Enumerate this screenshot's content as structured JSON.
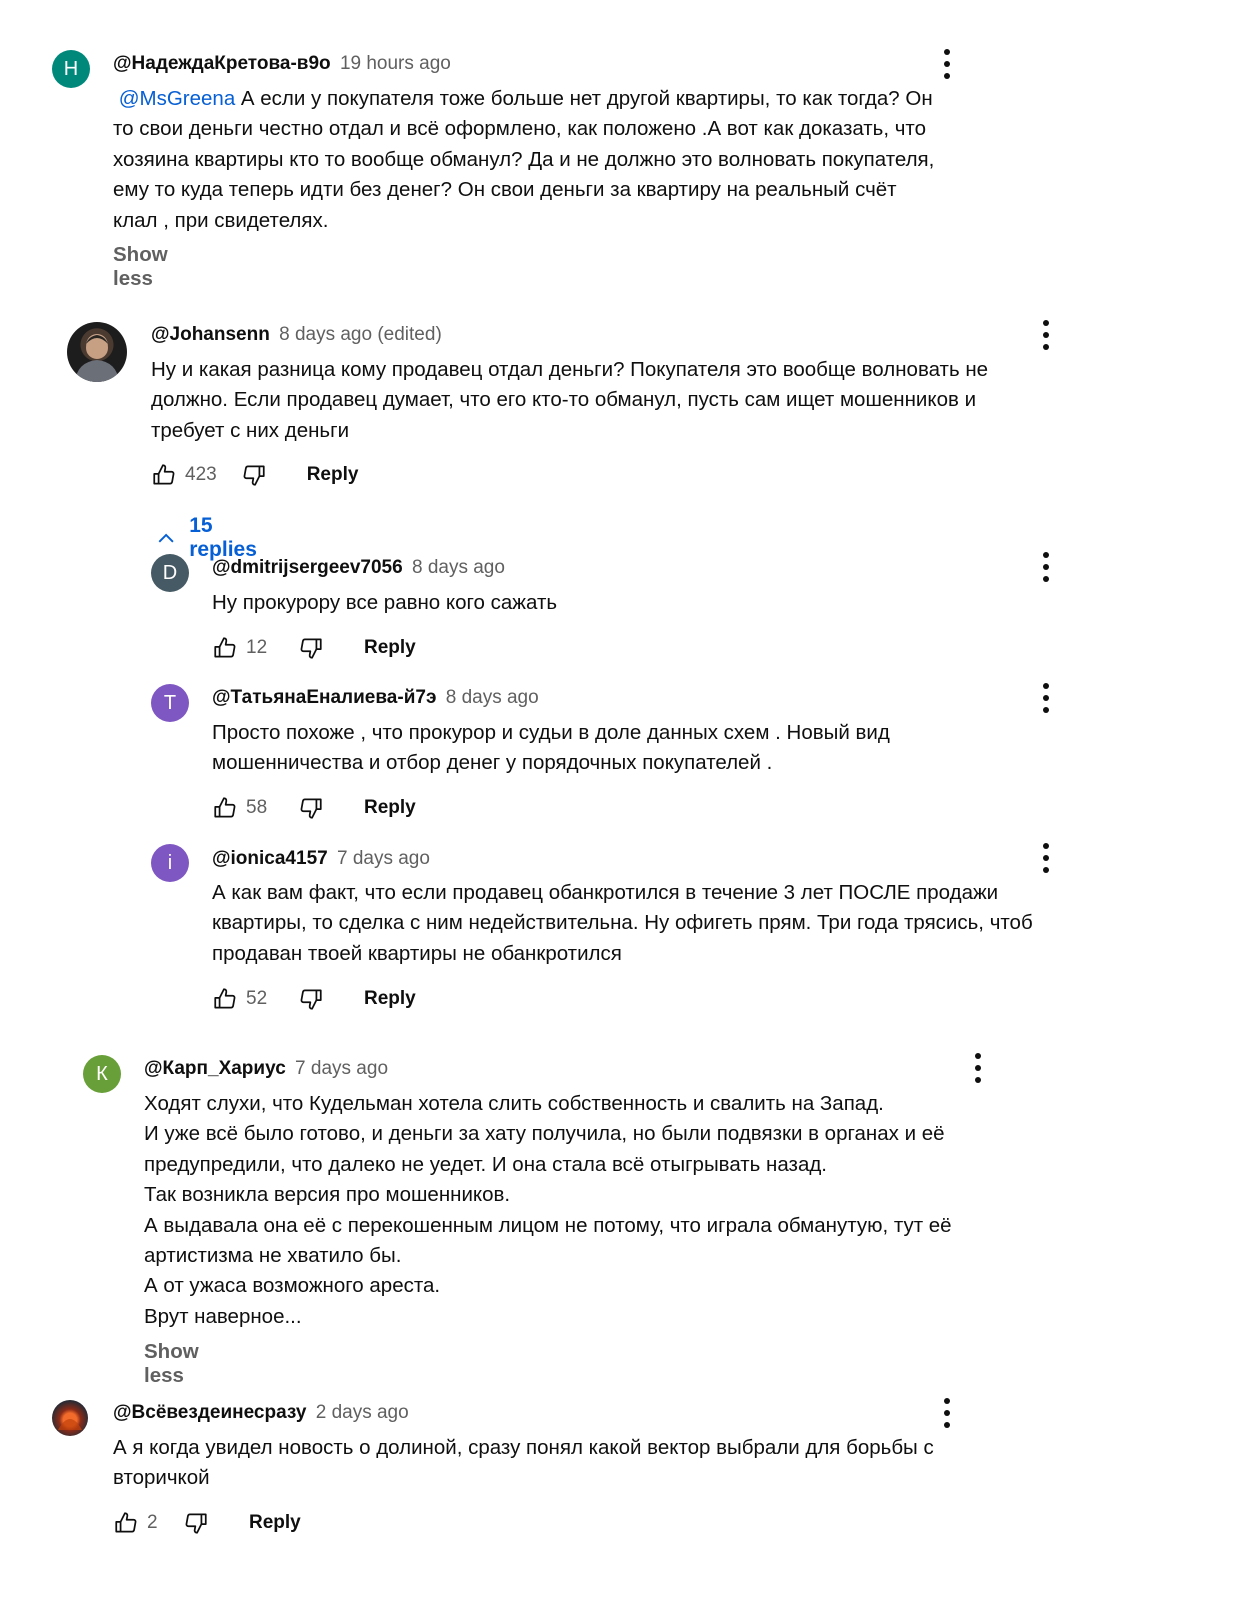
{
  "colors": {
    "link": "#065fd4",
    "muted": "#606060",
    "text": "#0f0f0f"
  },
  "comments": [
    {
      "author": "@НадеждаКретова-в9о",
      "time": "19 hours ago",
      "avatar_letter": "Н",
      "avatar_color": "#00897b",
      "mention": "@MsGreena",
      "text": "  А если у покупателя тоже больше нет другой квартиры, то как тогда? Он\nто свои деньги честно отдал и всё оформлено, как положено .А вот как доказать, что\nхозяина квартиры кто то вообще обманул? Да и не должно это волновать покупателя,\nему то куда теперь идти без денег? Он свои деньги за квартиру на реальный счёт\nклал , при свидетелях.",
      "show_less": "Show less"
    },
    {
      "author": "@Johansenn",
      "time": "8 days ago (edited)",
      "avatar_icon": "profile-photo",
      "text": "Ну и какая разница кому продавец отдал деньги? Покупателя это вообще волновать не\nдолжно. Если продавец думает, что его кто-то обманул, пусть сам ищет мошенников и\nтребует с них деньги",
      "likes": "423",
      "reply_label": "Reply",
      "replies_label": "15 replies"
    },
    {
      "author": "@dmitrijsergeev7056",
      "time": "8 days ago",
      "avatar_letter": "D",
      "avatar_color": "#455a64",
      "text": "Ну прокурору все равно кого сажать",
      "likes": "12",
      "reply_label": "Reply"
    },
    {
      "author": "@ТатьянаЕналиева-й7э",
      "time": "8 days ago",
      "avatar_letter": "Т",
      "avatar_color": "#7e57c2",
      "text": "Просто похоже , что  прокурор и судьи в доле данных схем . Новый вид\nмошенничества и отбор денег у порядочных покупателей .",
      "likes": "58",
      "reply_label": "Reply"
    },
    {
      "author": "@ionica4157",
      "time": "7 days ago",
      "avatar_letter": "i",
      "avatar_color": "#7e57c2",
      "text": "А как вам факт, что если продавец обанкротился в течение 3 лет ПОСЛЕ продажи\nквартиры, то сделка с ним недействительна. Ну офигеть прям. Три года трясись, чтоб\nпродаван твоей квартиры не обанкротился",
      "likes": "52",
      "reply_label": "Reply"
    },
    {
      "author": "@Карп_Хариус",
      "time": "7 days ago",
      "avatar_letter": "К",
      "avatar_color": "#689f38",
      "text": "Ходят слухи, что Кудельман хотела слить собственность и свалить на Запад.\nИ уже всё было готово, и деньги за хату получила, но были подвязки в органах и её\nпредупредили, что далеко не уедет. И она стала всё отыгрывать назад.\nТак возникла версия про мошенников.\nА выдавала она её с перекошенным лицом не потому, что играла обманутую, тут её\nартистизма не хватило бы.\nА от ужаса возможного ареста.\nВрут наверное...",
      "show_less": "Show less"
    },
    {
      "author": "@Всёвездеинесразу",
      "time": "2 days ago",
      "avatar_icon": "profile-photo",
      "text": "А я когда увидел новость о долиной, сразу понял какой вектор выбрали для борьбы с\nвторичкой",
      "likes": "2",
      "reply_label": "Reply"
    }
  ]
}
